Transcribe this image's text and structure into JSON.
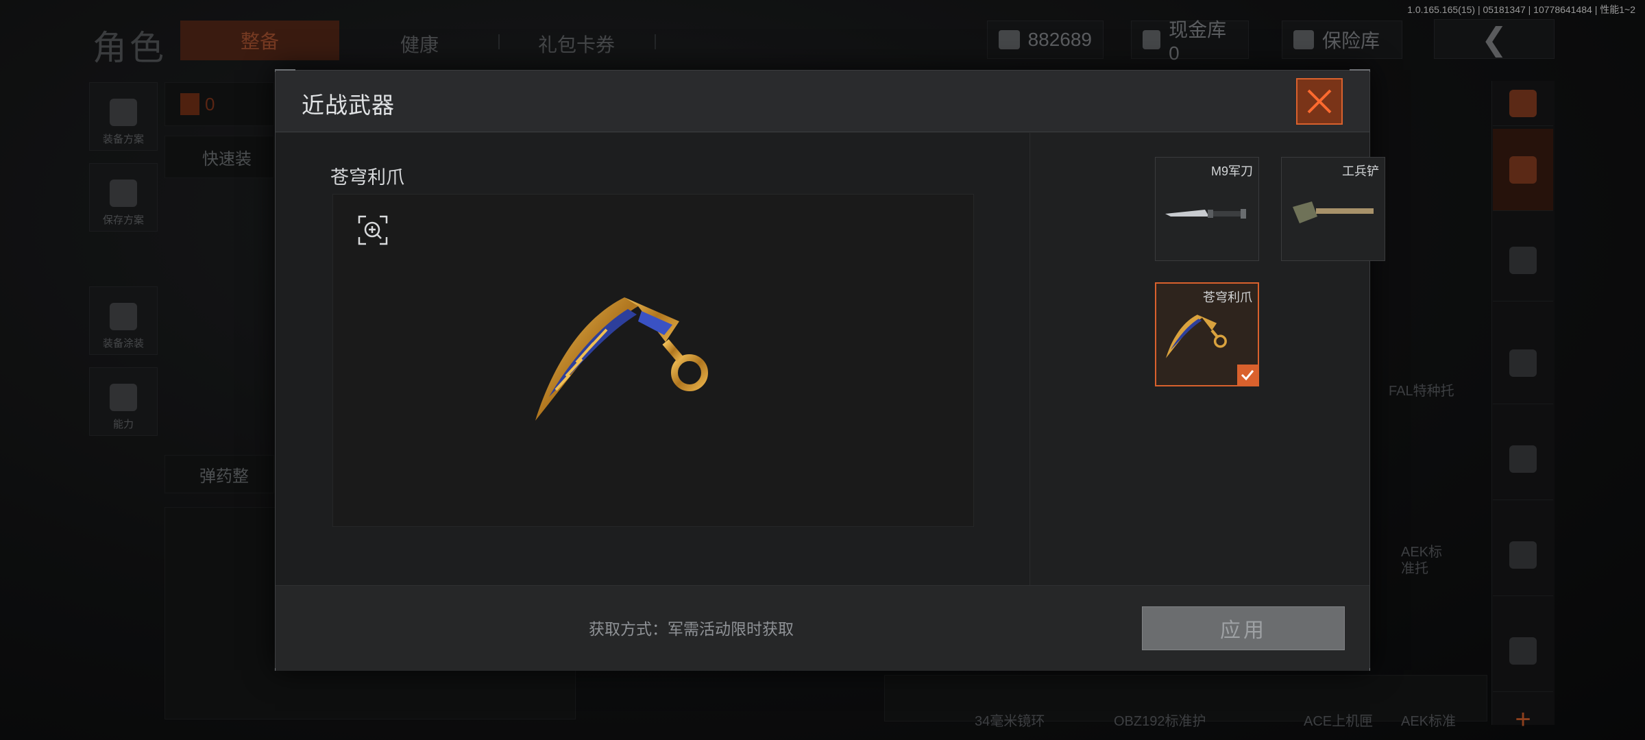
{
  "build_info": "1.0.165.165(15) | 05181347 | 10778641484 | 性能1~2",
  "background": {
    "title": "角色",
    "tabs": [
      "整备",
      "健康",
      "礼包卡券"
    ],
    "currency": "882689",
    "cash_vault": "现金库 0",
    "safe_box": "保险库",
    "side_buttons": [
      "装备方案",
      "保存方案",
      "装备涂装",
      "能力"
    ],
    "equip_count": "0",
    "quick_equip": "快速装",
    "ammo_sort": "弹药整",
    "right_labels": [
      "FAL特种托",
      "AEK标准托",
      "AEK标准"
    ],
    "bottom_labels": [
      "34毫米镜环",
      "OBZ192标准护",
      "ACE上机匣"
    ]
  },
  "modal": {
    "title": "近战武器",
    "selected_item": "苍穹利爪",
    "items": [
      {
        "name": "M9军刀",
        "selected": false,
        "icon": "bayonet-knife"
      },
      {
        "name": "工兵铲",
        "selected": false,
        "icon": "shovel"
      },
      {
        "name": "苍穹利爪",
        "selected": true,
        "icon": "karambit"
      }
    ],
    "acquire_text": "获取方式：军需活动限时获取",
    "apply_label": "应用"
  },
  "colors": {
    "accent": "#d9612d",
    "panel": "#232425",
    "preview": "#1a1a1a"
  }
}
